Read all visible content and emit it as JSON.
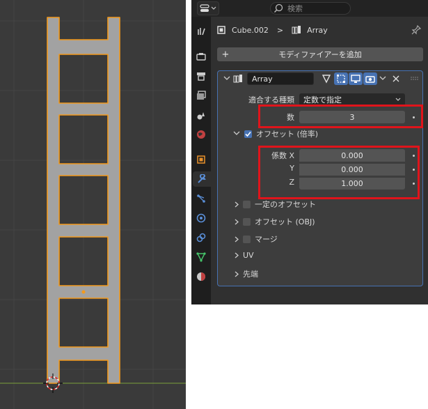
{
  "viewport": {
    "label": "3D viewport with ladder array object",
    "colors": {
      "background": "#3a3a3a",
      "mesh": "#a2a2a2",
      "outline": "#f39a1c",
      "axis": "#7ca03a"
    }
  },
  "topbar": {
    "editor_type_icon": "properties-editor-icon",
    "search_placeholder": "検索"
  },
  "tabs": [
    "tool-icon",
    "render-icon",
    "output-icon",
    "view-layer-icon",
    "scene-icon",
    "world-icon",
    "object-icon",
    "modifier-icon",
    "particles-icon",
    "physics-icon",
    "constraints-icon",
    "data-icon",
    "material-icon"
  ],
  "active_tab": "modifier-icon",
  "breadcrumb": {
    "object": "Cube.002",
    "separator": ">",
    "modifier": "Array"
  },
  "add_modifier_label": "モディファイアーを追加",
  "modifier": {
    "name": "Array",
    "fit_type_label": "適合する種類",
    "fit_type_value": "定数で指定",
    "count_label": "数",
    "count_value": "3",
    "relative_offset": {
      "title": "オフセット (倍率)",
      "enabled": true,
      "factor_x_label": "係数 X",
      "factor_x": "0.000",
      "factor_y_label": "Y",
      "factor_y": "0.000",
      "factor_z_label": "Z",
      "factor_z": "1.000"
    },
    "subpanels": [
      "一定のオフセット",
      "オフセット (OBJ)",
      "マージ"
    ],
    "subpanels_plain": [
      "UV",
      "先端"
    ]
  },
  "colors": {
    "accent_blue": "#4772b3",
    "highlight_red": "#e0141b",
    "panel_bg": "#303030",
    "field_bg": "#545454"
  }
}
